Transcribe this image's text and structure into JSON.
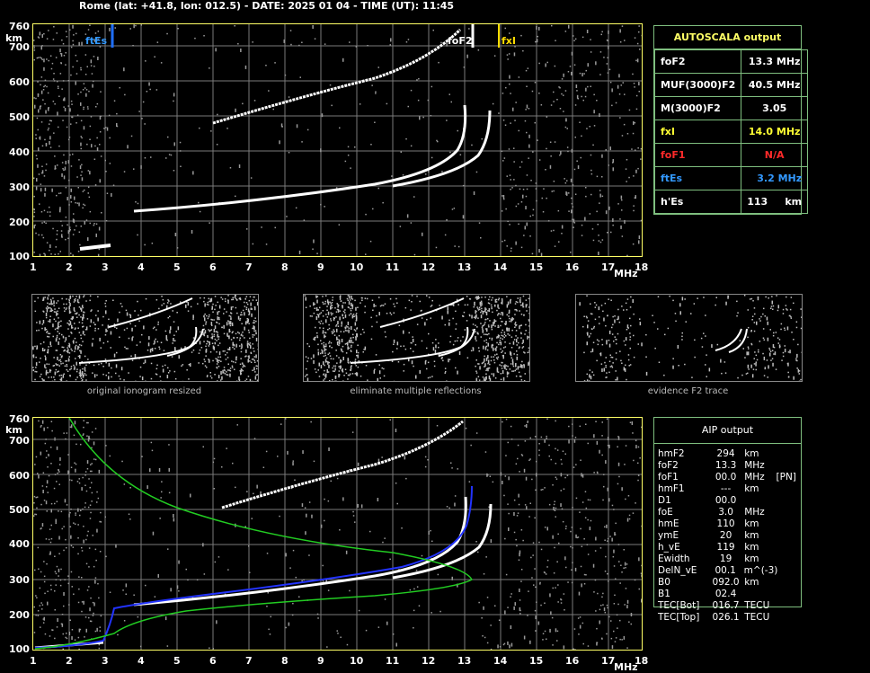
{
  "header": {
    "text": "Rome (lat: +41.8, lon: 012.5) - DATE: 2025 01 04 - TIME (UT): 11:45"
  },
  "axes": {
    "y_unit": "km",
    "x_unit": "MHz",
    "y_ticks": [
      "760",
      "700",
      "600",
      "500",
      "400",
      "300",
      "200",
      "100"
    ],
    "x_ticks": [
      "1",
      "2",
      "3",
      "4",
      "5",
      "6",
      "7",
      "8",
      "9",
      "10",
      "11",
      "12",
      "13",
      "14",
      "15",
      "16",
      "17",
      "18"
    ]
  },
  "markers": {
    "ftEs": "ftEs",
    "foF2": "foF2",
    "fxI": "fxI"
  },
  "autoscala": {
    "title": "AUTOSCALA output",
    "rows": [
      {
        "label": "foF2",
        "value": "13.3 MHz",
        "color": "#ffffff"
      },
      {
        "label": "MUF(3000)F2",
        "value": "40.5 MHz",
        "color": "#ffffff"
      },
      {
        "label": "M(3000)F2",
        "value": "3.05",
        "color": "#ffffff"
      },
      {
        "label": "fxI",
        "value": "14.0 MHz",
        "color": "#ffff33"
      },
      {
        "label": "foF1",
        "value": "N/A",
        "color": "#ff2a2a"
      },
      {
        "label": "ftEs",
        "value": "3.2 MHz",
        "color": "#3399ff"
      },
      {
        "label": "h'Es",
        "value": "113     km",
        "color": "#ffffff"
      }
    ]
  },
  "thumbnails": {
    "captions": [
      "original ionogram resized",
      "eliminate multiple reflections",
      "evidence F2 trace"
    ]
  },
  "aip": {
    "title": "AIP output",
    "rows": [
      {
        "name": "hmF2",
        "value": "294",
        "unit": "km",
        "extra": ""
      },
      {
        "name": "foF2",
        "value": "13.3",
        "unit": "MHz",
        "extra": ""
      },
      {
        "name": "foF1",
        "value": "00.0",
        "unit": "MHz",
        "extra": "[PN]"
      },
      {
        "name": "hmF1",
        "value": "---",
        "unit": "km",
        "extra": ""
      },
      {
        "name": "D1",
        "value": "00.0",
        "unit": "",
        "extra": ""
      },
      {
        "name": "foE",
        "value": "3.0",
        "unit": "MHz",
        "extra": ""
      },
      {
        "name": "hmE",
        "value": "110",
        "unit": "km",
        "extra": ""
      },
      {
        "name": "ymE",
        "value": "20",
        "unit": "km",
        "extra": ""
      },
      {
        "name": "h_vE",
        "value": "119",
        "unit": "km",
        "extra": ""
      },
      {
        "name": "Ewidth",
        "value": "19",
        "unit": "km",
        "extra": ""
      },
      {
        "name": "DelN_vE",
        "value": "00.1",
        "unit": "m^(-3)",
        "extra": ""
      },
      {
        "name": "B0",
        "value": "092.0",
        "unit": "km",
        "extra": ""
      },
      {
        "name": "B1",
        "value": "02.4",
        "unit": "",
        "extra": ""
      },
      {
        "name": "TEC[Bot]",
        "value": "016.7",
        "unit": "TECU",
        "extra": ""
      },
      {
        "name": "TEC[Top]",
        "value": "026.1",
        "unit": "TECU",
        "extra": ""
      }
    ]
  },
  "colors": {
    "grid": "#7a7a7a",
    "border": "#ffff66",
    "trace": "#ffffff",
    "profile": "#22cc22",
    "model": "#2233ff",
    "es": "#1f6fff",
    "fxi": "#ffdd00"
  }
}
